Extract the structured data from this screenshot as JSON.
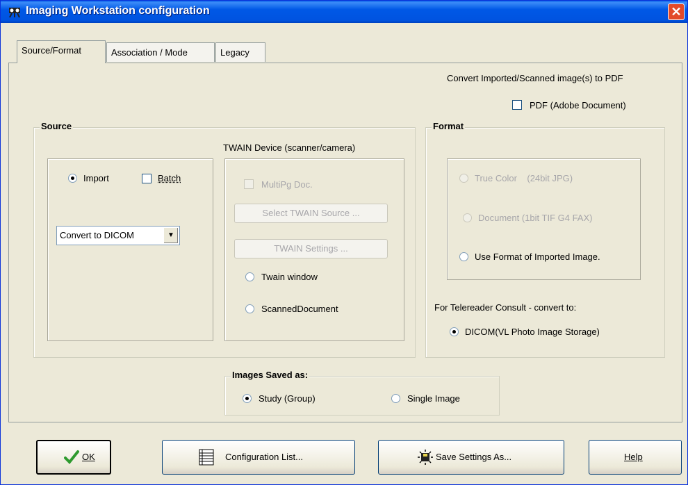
{
  "window": {
    "title": "Imaging Workstation configuration",
    "close_glyph": "✕"
  },
  "tabs": [
    {
      "label": "Source/Format",
      "active": true
    },
    {
      "label": "Association / Mode",
      "active": false
    },
    {
      "label": "Legacy",
      "active": false
    }
  ],
  "pdf": {
    "heading": "Convert Imported/Scanned image(s) to PDF",
    "checkbox_label": "PDF (Adobe Document)",
    "checked": false
  },
  "source": {
    "group_title": "Source",
    "import_label": "Import",
    "batch_label": "Batch",
    "convert_select_value": "Convert to DICOM",
    "twain": {
      "heading": "TWAIN Device (scanner/camera)",
      "multipg_label": "MultiPg Doc.",
      "select_source_label": "Select TWAIN Source ...",
      "settings_label": "TWAIN Settings ...",
      "twain_window_label": "Twain window",
      "scanned_document_label": "ScannedDocument"
    }
  },
  "format": {
    "group_title": "Format",
    "true_color_label": "True Color    (24bit JPG)",
    "document_label": "Document (1bit TIF G4 FAX)",
    "use_format_label": "Use Format of Imported Image.",
    "telereader_heading": "For Telereader Consult - convert to:",
    "dicom_label": "DICOM(VL Photo Image Storage)"
  },
  "saved_as": {
    "group_title": "Images Saved as:",
    "study_label": "Study (Group)",
    "single_label": "Single Image"
  },
  "buttons": {
    "ok": "OK",
    "config_list": "Configuration List...",
    "save_settings": "Save Settings As...",
    "help": "Help"
  },
  "icons": {
    "title": "projector-icon",
    "ok": "checkmark-icon",
    "config_list": "list-icon",
    "save": "save-disk-icon"
  }
}
